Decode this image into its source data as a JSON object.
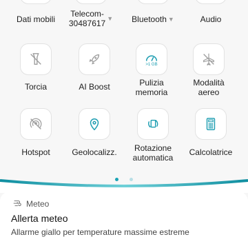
{
  "quick_settings": {
    "row1": [
      {
        "label": "Dati mobili",
        "caret": ""
      },
      {
        "label": "Telecom-\n30487617",
        "caret": "▼"
      },
      {
        "label": "Bluetooth",
        "caret": "▼"
      },
      {
        "label": "Audio",
        "caret": ""
      }
    ],
    "row2": [
      {
        "label": "Torcia",
        "icon": "flashlight-off-icon"
      },
      {
        "label": "AI Boost",
        "icon": "rocket-icon"
      },
      {
        "label": "Pulizia\nmemoria",
        "icon": "storage-gauge-icon",
        "badge": ">1 GB"
      },
      {
        "label": "Modalità\naereo",
        "icon": "airplane-icon"
      }
    ],
    "row3": [
      {
        "label": "Hotspot",
        "icon": "hotspot-icon"
      },
      {
        "label": "Geolocalizz.",
        "icon": "location-pin-icon"
      },
      {
        "label": "Rotazione\nautomatica",
        "icon": "auto-rotate-icon"
      },
      {
        "label": "Calcolatrice",
        "icon": "calculator-icon"
      }
    ],
    "page_indicator": {
      "pages": 2,
      "active": 0
    },
    "colors": {
      "accent": "#1aa3b5",
      "icon": "#9e9e9e",
      "icon_accent": "#1a9cb0"
    }
  },
  "notification": {
    "app_name": "Meteo",
    "title": "Allerta meteo",
    "body": "Allarme giallo per temperature massime estreme"
  }
}
